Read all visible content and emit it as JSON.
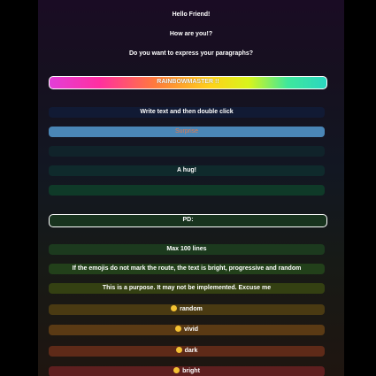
{
  "header": {
    "greeting": "Hello Friend!",
    "question": "How are you!?",
    "prompt": "Do you want to express your paragraphs?"
  },
  "rainbow_button": {
    "label": "RAINBOWMASTER !!"
  },
  "rows": [
    {
      "text": "Write text and then double click",
      "color": "#111a34"
    },
    {
      "text": "Surprise",
      "color": "#4a86b6",
      "text_color": "#e07a50"
    },
    {
      "text": "",
      "color": "#10232a"
    },
    {
      "text": "A hug!",
      "color": "#0f2a2c"
    },
    {
      "text": "",
      "color": "#0f3a28"
    }
  ],
  "pd_button": {
    "label": "PD:"
  },
  "rows2": [
    {
      "text": "Max 100 lines",
      "color": "#1c3a1e"
    },
    {
      "text": "If the emojis do not mark the route, the text is bright, progressive and random",
      "color": "#22401a"
    },
    {
      "text": "This is a purpose. It may not be implemented. Excuse me",
      "color": "#344012"
    },
    {
      "text": "random",
      "color": "#4a3a12",
      "emoji": "grinning-face-icon"
    },
    {
      "text": "vivid",
      "color": "#5a3a14",
      "emoji": "smiling-face-icon"
    },
    {
      "text": "dark",
      "color": "#5e2a18",
      "emoji": "smiling-face-icon"
    },
    {
      "text": "bright",
      "color": "#5e1f1f",
      "emoji": "smiling-face-icon"
    }
  ]
}
